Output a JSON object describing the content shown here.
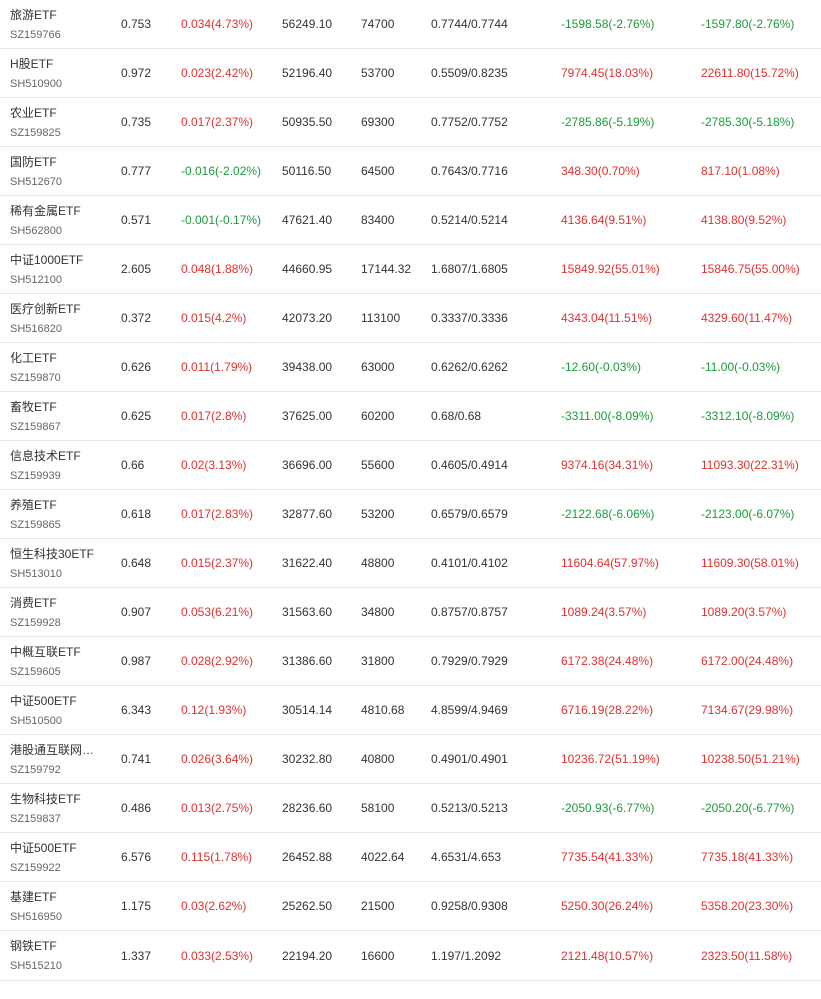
{
  "colors": {
    "up": "#e0312f",
    "down": "#1d9a3d",
    "text": "#333333",
    "code": "#666666",
    "border": "#e8e8e8"
  },
  "rows": [
    {
      "name": "旅游ETF",
      "code": "SZ159766",
      "price": "0.753",
      "change": "0.034(4.73%)",
      "change_dir": "up",
      "vol": "56249.10",
      "amount": "74700",
      "nav": "0.7744/0.7744",
      "pnl1": "-1598.58(-2.76%)",
      "pnl1_dir": "down",
      "pnl2": "-1597.80(-2.76%)",
      "pnl2_dir": "down"
    },
    {
      "name": "H股ETF",
      "code": "SH510900",
      "price": "0.972",
      "change": "0.023(2.42%)",
      "change_dir": "up",
      "vol": "52196.40",
      "amount": "53700",
      "nav": "0.5509/0.8235",
      "pnl1": "7974.45(18.03%)",
      "pnl1_dir": "up",
      "pnl2": "22611.80(15.72%)",
      "pnl2_dir": "up"
    },
    {
      "name": "农业ETF",
      "code": "SZ159825",
      "price": "0.735",
      "change": "0.017(2.37%)",
      "change_dir": "up",
      "vol": "50935.50",
      "amount": "69300",
      "nav": "0.7752/0.7752",
      "pnl1": "-2785.86(-5.19%)",
      "pnl1_dir": "down",
      "pnl2": "-2785.30(-5.18%)",
      "pnl2_dir": "down"
    },
    {
      "name": "国防ETF",
      "code": "SH512670",
      "price": "0.777",
      "change": "-0.016(-2.02%)",
      "change_dir": "down",
      "vol": "50116.50",
      "amount": "64500",
      "nav": "0.7643/0.7716",
      "pnl1": "348.30(0.70%)",
      "pnl1_dir": "up",
      "pnl2": "817.10(1.08%)",
      "pnl2_dir": "up"
    },
    {
      "name": "稀有金属ETF",
      "code": "SH562800",
      "price": "0.571",
      "change": "-0.001(-0.17%)",
      "change_dir": "down",
      "vol": "47621.40",
      "amount": "83400",
      "nav": "0.5214/0.5214",
      "pnl1": "4136.64(9.51%)",
      "pnl1_dir": "up",
      "pnl2": "4138.80(9.52%)",
      "pnl2_dir": "up"
    },
    {
      "name": "中证1000ETF",
      "code": "SH512100",
      "price": "2.605",
      "change": "0.048(1.88%)",
      "change_dir": "up",
      "vol": "44660.95",
      "amount": "17144.32",
      "nav": "1.6807/1.6805",
      "pnl1": "15849.92(55.01%)",
      "pnl1_dir": "up",
      "pnl2": "15846.75(55.00%)",
      "pnl2_dir": "up"
    },
    {
      "name": "医疗创新ETF",
      "code": "SH516820",
      "price": "0.372",
      "change": "0.015(4.2%)",
      "change_dir": "up",
      "vol": "42073.20",
      "amount": "113100",
      "nav": "0.3337/0.3336",
      "pnl1": "4343.04(11.51%)",
      "pnl1_dir": "up",
      "pnl2": "4329.60(11.47%)",
      "pnl2_dir": "up"
    },
    {
      "name": "化工ETF",
      "code": "SZ159870",
      "price": "0.626",
      "change": "0.011(1.79%)",
      "change_dir": "up",
      "vol": "39438.00",
      "amount": "63000",
      "nav": "0.6262/0.6262",
      "pnl1": "-12.60(-0.03%)",
      "pnl1_dir": "down",
      "pnl2": "-11.00(-0.03%)",
      "pnl2_dir": "down"
    },
    {
      "name": "畜牧ETF",
      "code": "SZ159867",
      "price": "0.625",
      "change": "0.017(2.8%)",
      "change_dir": "up",
      "vol": "37625.00",
      "amount": "60200",
      "nav": "0.68/0.68",
      "pnl1": "-3311.00(-8.09%)",
      "pnl1_dir": "down",
      "pnl2": "-3312.10(-8.09%)",
      "pnl2_dir": "down"
    },
    {
      "name": "信息技术ETF",
      "code": "SZ159939",
      "price": "0.66",
      "change": "0.02(3.13%)",
      "change_dir": "up",
      "vol": "36696.00",
      "amount": "55600",
      "nav": "0.4605/0.4914",
      "pnl1": "9374.16(34.31%)",
      "pnl1_dir": "up",
      "pnl2": "11093.30(22.31%)",
      "pnl2_dir": "up"
    },
    {
      "name": "养殖ETF",
      "code": "SZ159865",
      "price": "0.618",
      "change": "0.017(2.83%)",
      "change_dir": "up",
      "vol": "32877.60",
      "amount": "53200",
      "nav": "0.6579/0.6579",
      "pnl1": "-2122.68(-6.06%)",
      "pnl1_dir": "down",
      "pnl2": "-2123.00(-6.07%)",
      "pnl2_dir": "down"
    },
    {
      "name": "恒生科技30ETF",
      "code": "SH513010",
      "price": "0.648",
      "change": "0.015(2.37%)",
      "change_dir": "up",
      "vol": "31622.40",
      "amount": "48800",
      "nav": "0.4101/0.4102",
      "pnl1": "11604.64(57.97%)",
      "pnl1_dir": "up",
      "pnl2": "11609.30(58.01%)",
      "pnl2_dir": "up"
    },
    {
      "name": "消费ETF",
      "code": "SZ159928",
      "price": "0.907",
      "change": "0.053(6.21%)",
      "change_dir": "up",
      "vol": "31563.60",
      "amount": "34800",
      "nav": "0.8757/0.8757",
      "pnl1": "1089.24(3.57%)",
      "pnl1_dir": "up",
      "pnl2": "1089.20(3.57%)",
      "pnl2_dir": "up"
    },
    {
      "name": "中概互联ETF",
      "code": "SZ159605",
      "price": "0.987",
      "change": "0.028(2.92%)",
      "change_dir": "up",
      "vol": "31386.60",
      "amount": "31800",
      "nav": "0.7929/0.7929",
      "pnl1": "6172.38(24.48%)",
      "pnl1_dir": "up",
      "pnl2": "6172.00(24.48%)",
      "pnl2_dir": "up"
    },
    {
      "name": "中证500ETF",
      "code": "SH510500",
      "price": "6.343",
      "change": "0.12(1.93%)",
      "change_dir": "up",
      "vol": "30514.14",
      "amount": "4810.68",
      "nav": "4.8599/4.9469",
      "pnl1": "6716.19(28.22%)",
      "pnl1_dir": "up",
      "pnl2": "7134.67(29.98%)",
      "pnl2_dir": "up"
    },
    {
      "name": "港股通互联网…",
      "code": "SZ159792",
      "price": "0.741",
      "change": "0.026(3.64%)",
      "change_dir": "up",
      "vol": "30232.80",
      "amount": "40800",
      "nav": "0.4901/0.4901",
      "pnl1": "10236.72(51.19%)",
      "pnl1_dir": "up",
      "pnl2": "10238.50(51.21%)",
      "pnl2_dir": "up"
    },
    {
      "name": "生物科技ETF",
      "code": "SZ159837",
      "price": "0.486",
      "change": "0.013(2.75%)",
      "change_dir": "up",
      "vol": "28236.60",
      "amount": "58100",
      "nav": "0.5213/0.5213",
      "pnl1": "-2050.93(-6.77%)",
      "pnl1_dir": "down",
      "pnl2": "-2050.20(-6.77%)",
      "pnl2_dir": "down"
    },
    {
      "name": "中证500ETF",
      "code": "SZ159922",
      "price": "6.576",
      "change": "0.115(1.78%)",
      "change_dir": "up",
      "vol": "26452.88",
      "amount": "4022.64",
      "nav": "4.6531/4.653",
      "pnl1": "7735.54(41.33%)",
      "pnl1_dir": "up",
      "pnl2": "7735.18(41.33%)",
      "pnl2_dir": "up"
    },
    {
      "name": "基建ETF",
      "code": "SH516950",
      "price": "1.175",
      "change": "0.03(2.62%)",
      "change_dir": "up",
      "vol": "25262.50",
      "amount": "21500",
      "nav": "0.9258/0.9308",
      "pnl1": "5250.30(26.24%)",
      "pnl1_dir": "up",
      "pnl2": "5358.20(23.30%)",
      "pnl2_dir": "up"
    },
    {
      "name": "钢铁ETF",
      "code": "SH515210",
      "price": "1.337",
      "change": "0.033(2.53%)",
      "change_dir": "up",
      "vol": "22194.20",
      "amount": "16600",
      "nav": "1.197/1.2092",
      "pnl1": "2121.48(10.57%)",
      "pnl1_dir": "up",
      "pnl2": "2323.50(11.58%)",
      "pnl2_dir": "up"
    }
  ]
}
